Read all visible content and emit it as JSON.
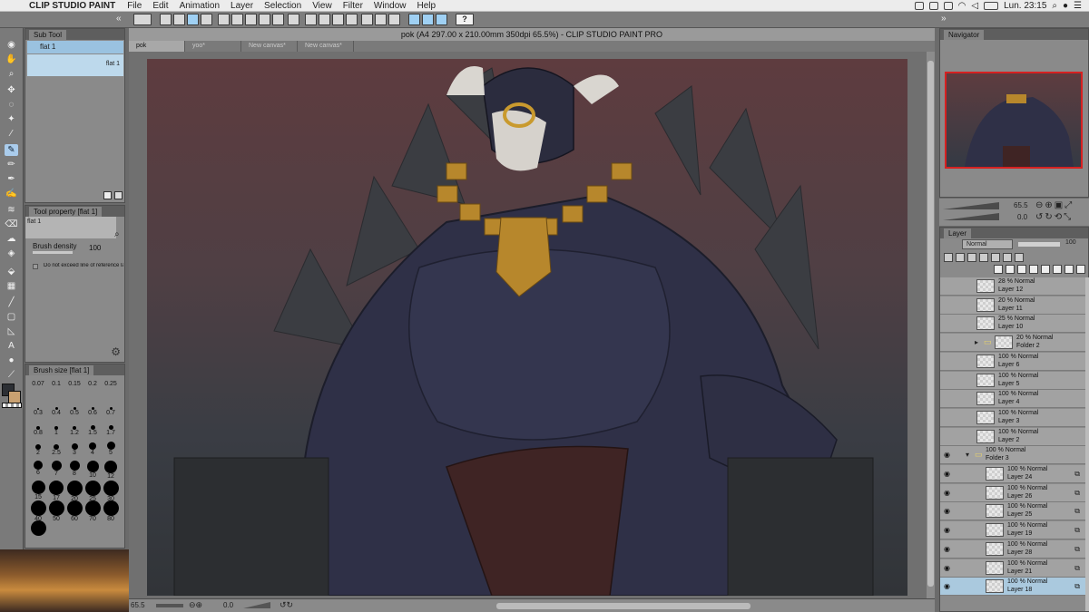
{
  "menubar": {
    "app_name": "CLIP STUDIO PAINT",
    "items": [
      "File",
      "Edit",
      "Animation",
      "Layer",
      "Selection",
      "View",
      "Filter",
      "Window",
      "Help"
    ],
    "clock": "Lun. 23:15"
  },
  "toolbar": {
    "help_label": "?"
  },
  "subtool": {
    "title": "Sub Tool",
    "item": "flat 1",
    "preview_label": "flat 1"
  },
  "tool_property": {
    "title": "Tool property [flat 1]",
    "item": "flat 1",
    "brush_density_label": "Brush density",
    "brush_density_value": "100",
    "exceed_option": "Do not exceed line of reference lay"
  },
  "brush_size": {
    "title": "Brush size [flat 1]",
    "sizes": [
      "0.07",
      "0.1",
      "0.15",
      "0.2",
      "0.25",
      "0.3",
      "0.4",
      "0.5",
      "0.6",
      "0.7",
      "0.8",
      "1",
      "1.2",
      "1.5",
      "1.7",
      "2",
      "2.5",
      "3",
      "4",
      "5",
      "6",
      "7",
      "8",
      "10",
      "12",
      "15",
      "17",
      "20",
      "25",
      "30",
      "40",
      "50",
      "60",
      "70",
      "80",
      "100"
    ]
  },
  "document": {
    "title": "pok (A4 297.00 x 210.00mm 350dpi 65.5%) - CLIP STUDIO PAINT PRO",
    "tabs": [
      "pok",
      "yoo*",
      "New canvas*",
      "New canvas*"
    ]
  },
  "status": {
    "zoom": "65.5",
    "angle": "0.0"
  },
  "navigator": {
    "title": "Navigator",
    "zoom": "65.5",
    "rotation": "0.0"
  },
  "layer_panel": {
    "title": "Layer",
    "blend_mode": "Normal",
    "opacity": "100",
    "layers": [
      {
        "mode": "28 % Normal",
        "name": "Layer 12",
        "indent": 1
      },
      {
        "mode": "20 % Normal",
        "name": "Layer 11",
        "indent": 1
      },
      {
        "mode": "25 % Normal",
        "name": "Layer 10",
        "indent": 1
      },
      {
        "mode": "20 % Normal",
        "name": "Folder 2",
        "indent": 1,
        "folder": true
      },
      {
        "mode": "100 % Normal",
        "name": "Layer 6",
        "indent": 1
      },
      {
        "mode": "100 % Normal",
        "name": "Layer 5",
        "indent": 1
      },
      {
        "mode": "100 % Normal",
        "name": "Layer 4",
        "indent": 1
      },
      {
        "mode": "100 % Normal",
        "name": "Layer 3",
        "indent": 1
      },
      {
        "mode": "100 % Normal",
        "name": "Layer 2",
        "indent": 1
      },
      {
        "mode": "100 % Normal",
        "name": "Folder 3",
        "indent": 0,
        "folder": true
      },
      {
        "mode": "100 % Normal",
        "name": "Layer 24",
        "indent": 2
      },
      {
        "mode": "100 % Normal",
        "name": "Layer 26",
        "indent": 2
      },
      {
        "mode": "100 % Normal",
        "name": "Layer 25",
        "indent": 2
      },
      {
        "mode": "100 % Normal",
        "name": "Layer 19",
        "indent": 2
      },
      {
        "mode": "100 % Normal",
        "name": "Layer 28",
        "indent": 2
      },
      {
        "mode": "100 % Normal",
        "name": "Layer 21",
        "indent": 2
      },
      {
        "mode": "100 % Normal",
        "name": "Layer 18",
        "indent": 2,
        "selected": true
      }
    ]
  },
  "colors": {
    "accent": "#aac9de",
    "nav_frame": "#d62121",
    "bg_panel": "#8a8a8a"
  }
}
